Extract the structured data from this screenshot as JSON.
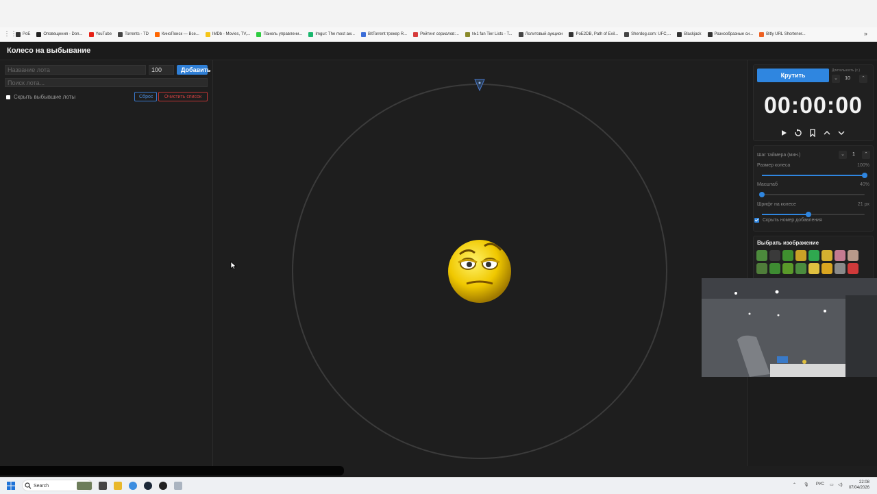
{
  "bookmarks": {
    "items": [
      {
        "label": "PoE",
        "color": "#333333"
      },
      {
        "label": "Оповещения - Don...",
        "color": "#222222"
      },
      {
        "label": "YouTube",
        "color": "#e62117"
      },
      {
        "label": "Torrents - TD",
        "color": "#444444"
      },
      {
        "label": "КиноПоиск — Все...",
        "color": "#ff6600"
      },
      {
        "label": "IMDb - Movies, TV,...",
        "color": "#f5c518"
      },
      {
        "label": "Панель управлени...",
        "color": "#2ecc40"
      },
      {
        "label": "Imgur: The most aw...",
        "color": "#1bb76e"
      },
      {
        "label": "BitTorrent трекер R...",
        "color": "#3b6dd8"
      },
      {
        "label": "Рейтинг сериалов:...",
        "color": "#d63b3b"
      },
      {
        "label": "№1 fan Tier Lists - T...",
        "color": "#8a8a2a"
      },
      {
        "label": "Лолитовый аукцион",
        "color": "#444444"
      },
      {
        "label": "PoE2DB, Path of Exil...",
        "color": "#333333"
      },
      {
        "label": "Sherdog.com: UFC,...",
        "color": "#444444"
      },
      {
        "label": "Blackjack",
        "color": "#333333"
      },
      {
        "label": "Разнообразные си...",
        "color": "#333333"
      },
      {
        "label": "Bitly URL Shortener...",
        "color": "#ee6123"
      }
    ]
  },
  "app": {
    "title": "Колесо на выбывание"
  },
  "left": {
    "lot_name_placeholder": "Название лота",
    "amount_value": "100",
    "add_label": "Добавить",
    "search_placeholder": "Поиск лота...",
    "hide_label": "Скрыть выбывшие лоты",
    "reset_label": "Сброс",
    "clear_label": "Очистить список"
  },
  "controls": {
    "spin_label": "Крутить",
    "duration_label": "Длительность (с.)",
    "duration_value": "10",
    "timer": "00:00:00",
    "timer_step_label": "Шаг таймера (мин.)",
    "timer_step_value": "1",
    "wheel_size_label": "Размер колеса",
    "wheel_size_value": "100%",
    "wheel_size_level": 1.0,
    "scale_label": "Масштаб",
    "scale_value": "40%",
    "scale_level": 0.0,
    "font_label": "Шрифт на колесе",
    "font_value": "21 px",
    "font_level": 0.45,
    "hide_number_label": "Скрыть номер добавления",
    "accent": "#2f86e0"
  },
  "images": {
    "title": "Выбрать изображение",
    "thumbs": [
      "#4c8a3c",
      "#3a3a3a",
      "#3f8f2f",
      "#c9a227",
      "#2fa84f",
      "#d4b030",
      "#c47a90",
      "#b89a8a",
      "#4f7d3a",
      "#3e8c32",
      "#5a9a2a",
      "#4b8c3e",
      "#e0c040",
      "#d9a520",
      "#8a8a8a",
      "#d03a3a"
    ]
  },
  "taskbar": {
    "search_label": "Search",
    "lang": "РУС",
    "time": "22:08",
    "date": "07/04/2026"
  }
}
